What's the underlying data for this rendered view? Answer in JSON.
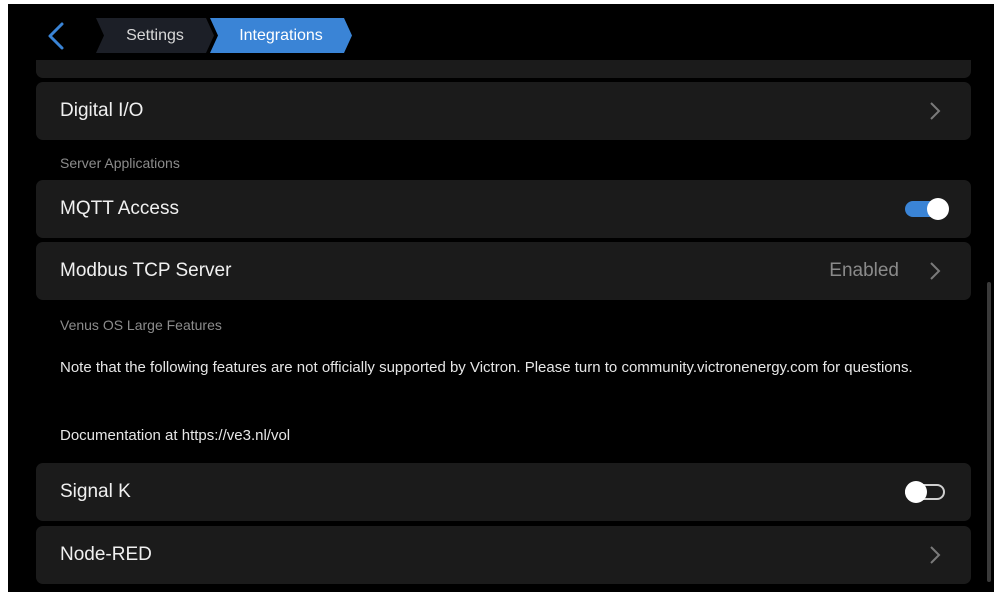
{
  "topbar": {
    "back_icon": "chevron-left-icon",
    "breadcrumbs": [
      "Settings",
      "Integrations"
    ]
  },
  "items": {
    "digital_io": {
      "label": "Digital I/O"
    },
    "mqtt_access": {
      "label": "MQTT Access",
      "toggle": true
    },
    "modbus_tcp": {
      "label": "Modbus TCP Server",
      "value": "Enabled"
    },
    "signal_k": {
      "label": "Signal K",
      "toggle": false
    },
    "node_red": {
      "label": "Node-RED"
    }
  },
  "sections": {
    "server_applications": "Server Applications",
    "venus_large": "Venus OS Large Features"
  },
  "notes": {
    "support_note": "Note that the following features are not officially supported by Victron. Please turn to community.victronenergy.com for questions.",
    "documentation": "Documentation at https://ve3.nl/vol"
  },
  "colors": {
    "accent": "#3a84d6",
    "background": "#000000",
    "row_background": "#1b1b1b"
  }
}
